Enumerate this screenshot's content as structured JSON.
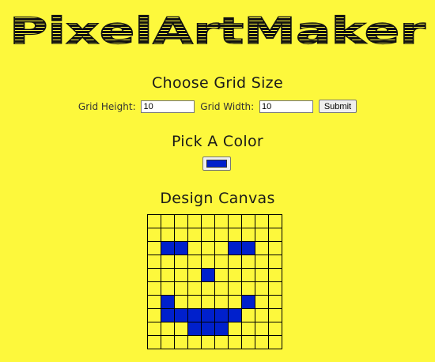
{
  "logo": {
    "text": "PixelArtMaker",
    "alt": "Pixel Art Maker"
  },
  "grid_size": {
    "title": "Choose Grid Size",
    "height_label": "Grid Height:",
    "height_value": "10",
    "width_label": "Grid Width:",
    "width_value": "10",
    "submit_label": "Submit"
  },
  "color": {
    "title": "Pick A Color",
    "value": "#0020cc"
  },
  "canvas": {
    "title": "Design Canvas",
    "rows": 10,
    "cols": 10,
    "fill_color": "#0020cc",
    "empty_color": "#fdf83c",
    "pixels": [
      "0000000000",
      "0000000000",
      "0110001100",
      "0000000000",
      "0000100000",
      "0000000000",
      "0100000100",
      "0111111000",
      "0001110000",
      "0000000000"
    ]
  },
  "colors": {
    "background": "#fdf83c",
    "text": "#1a1a1a",
    "pixel_fill": "#0020cc"
  }
}
